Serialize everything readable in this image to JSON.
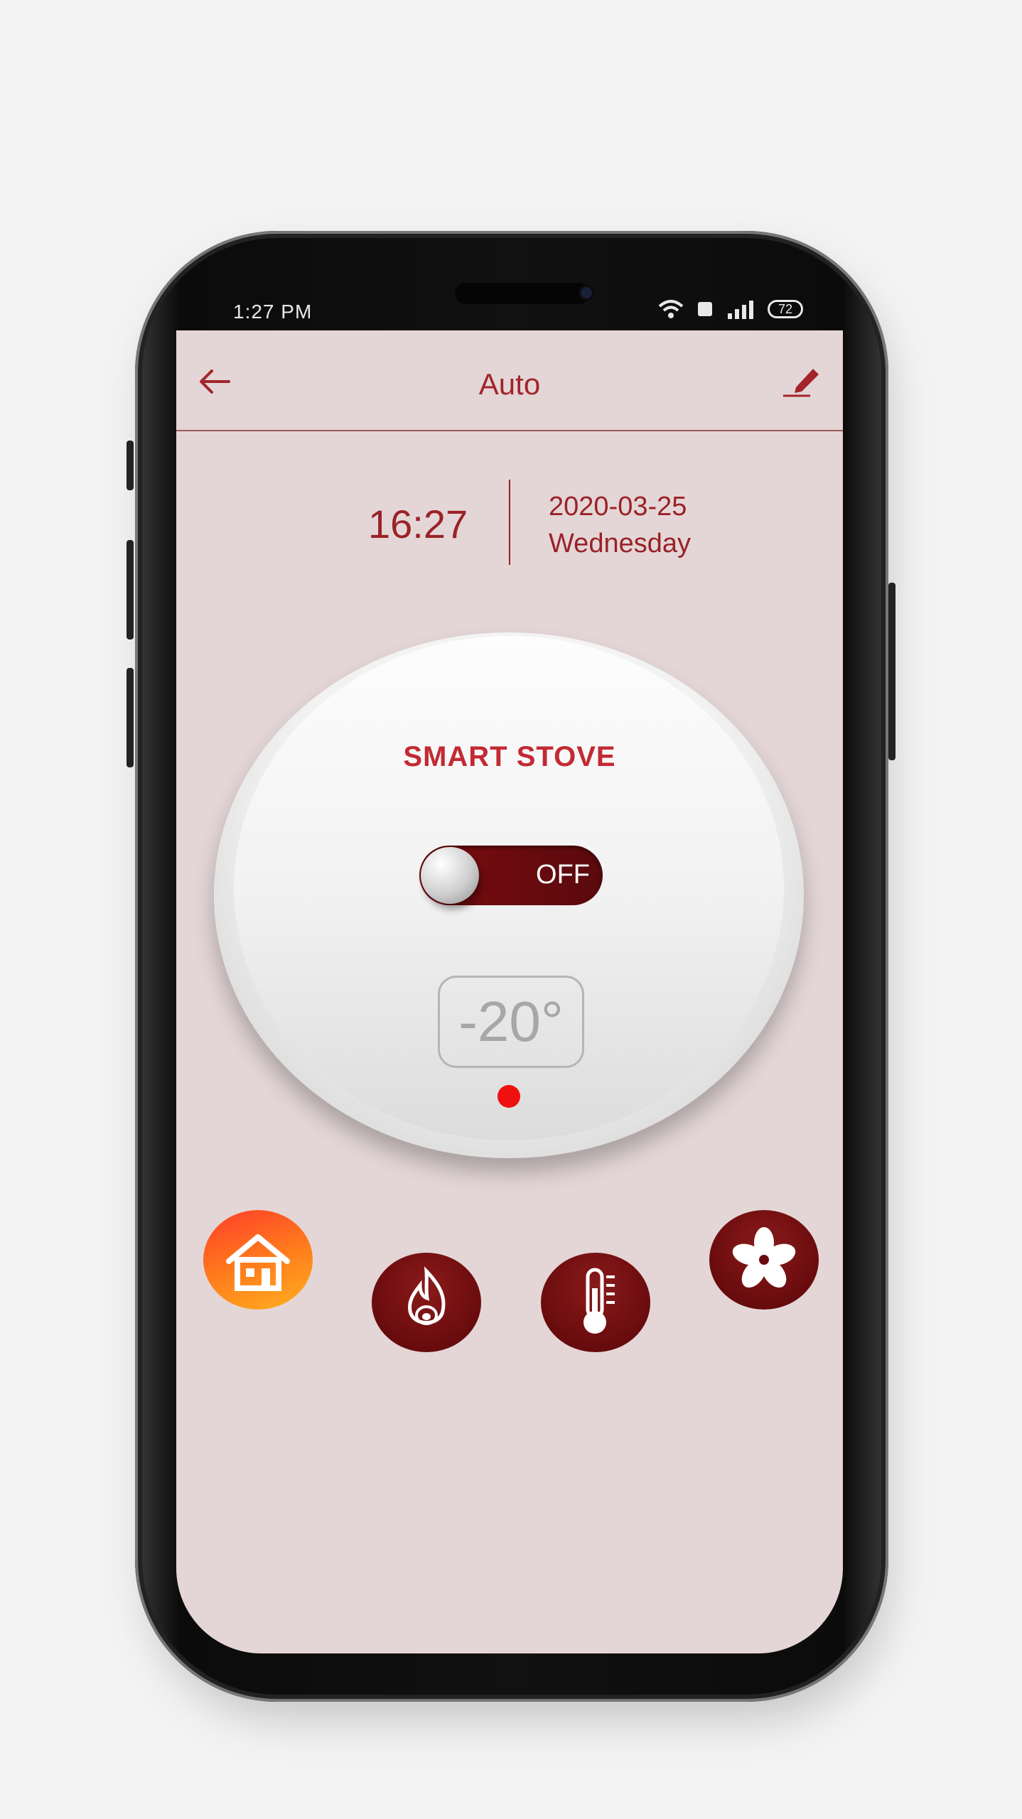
{
  "status_bar": {
    "time": "1:27 PM",
    "battery": "72"
  },
  "header": {
    "title": "Auto"
  },
  "datetime": {
    "time": "16:27",
    "date": "2020-03-25",
    "weekday": "Wednesday"
  },
  "dial": {
    "brand": "SMART STOVE",
    "power_label": "OFF",
    "temperature": "-20°"
  },
  "modes": [
    {
      "icon": "home-icon",
      "active": true
    },
    {
      "icon": "flame-icon",
      "active": false
    },
    {
      "icon": "thermometer-icon",
      "active": false
    },
    {
      "icon": "fan-icon",
      "active": false
    }
  ],
  "colors": {
    "accent": "#a3242a",
    "screen_bg": "#e4d6d6",
    "toggle_bg": "#6a0b0e",
    "active_mode": "#ff7a1c",
    "indicator": "#f01010"
  }
}
